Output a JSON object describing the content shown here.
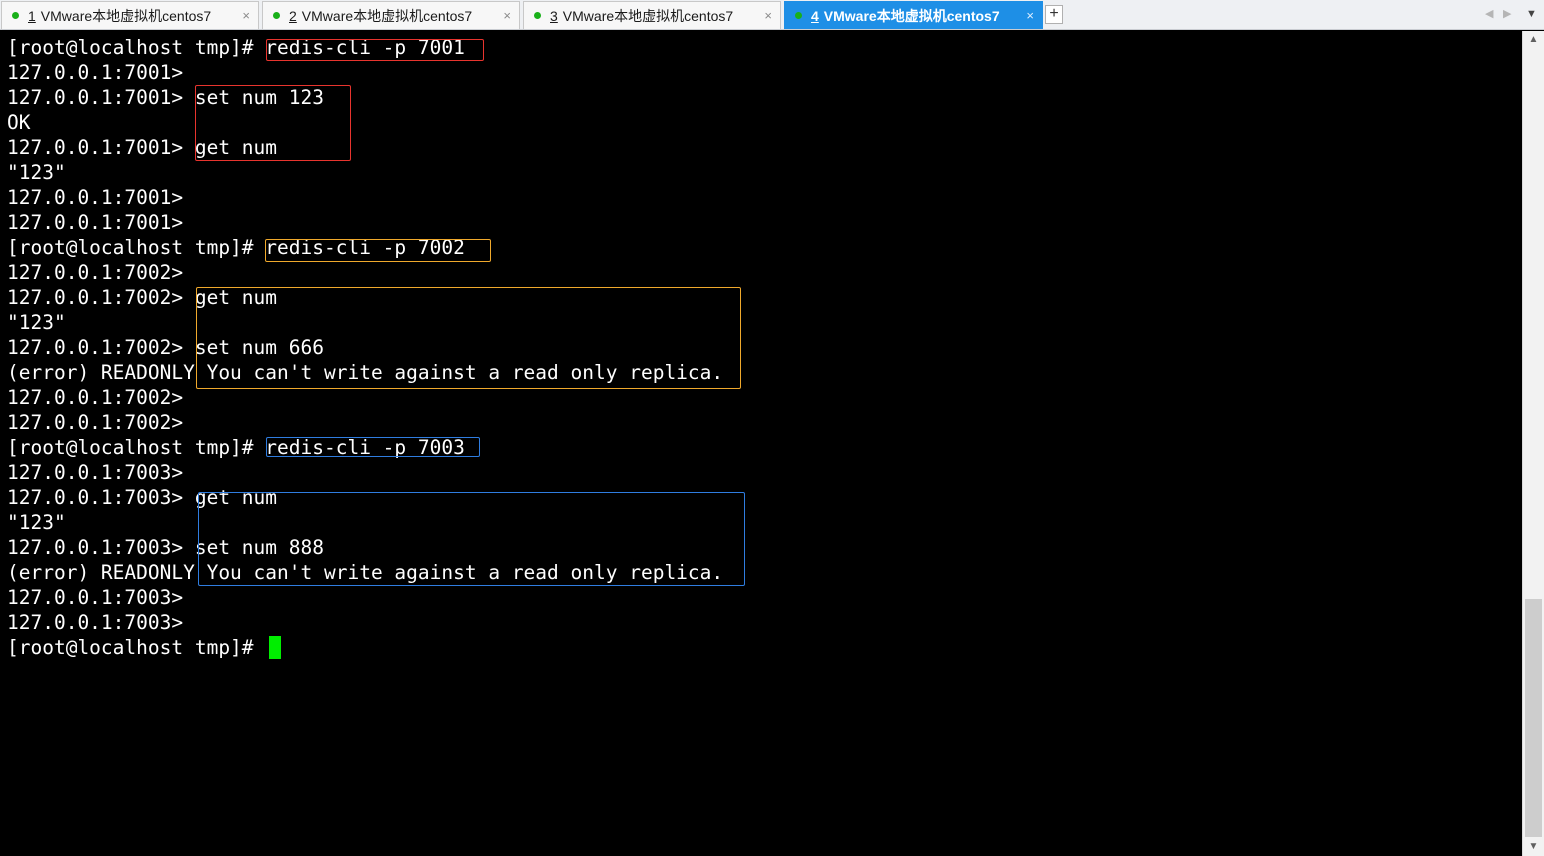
{
  "tabs": [
    {
      "number": "1",
      "title": "VMware本地虚拟机centos7",
      "active": false
    },
    {
      "number": "2",
      "title": "VMware本地虚拟机centos7",
      "active": false
    },
    {
      "number": "3",
      "title": "VMware本地虚拟机centos7",
      "active": false
    },
    {
      "number": "4",
      "title": "VMware本地虚拟机centos7",
      "active": true
    }
  ],
  "icons": {
    "close": "×",
    "add": "+",
    "nav_left": "◀",
    "nav_right": "▶",
    "menu": "▼",
    "scroll_up": "▲",
    "scroll_down": "▼"
  },
  "terminal": {
    "lines": [
      "[root@localhost tmp]# redis-cli -p 7001",
      "127.0.0.1:7001>",
      "127.0.0.1:7001> set num 123",
      "OK",
      "127.0.0.1:7001> get num",
      "\"123\"",
      "127.0.0.1:7001>",
      "127.0.0.1:7001>",
      "[root@localhost tmp]# redis-cli -p 7002",
      "127.0.0.1:7002>",
      "127.0.0.1:7002> get num",
      "\"123\"",
      "127.0.0.1:7002> set num 666",
      "(error) READONLY You can't write against a read only replica.",
      "127.0.0.1:7002>",
      "127.0.0.1:7002>",
      "[root@localhost tmp]# redis-cli -p 7003",
      "127.0.0.1:7003>",
      "127.0.0.1:7003> get num",
      "\"123\"",
      "127.0.0.1:7003> set num 888",
      "(error) READONLY You can't write against a read only replica.",
      "127.0.0.1:7003>",
      "127.0.0.1:7003>",
      "[root@localhost tmp]# "
    ]
  },
  "colors": {
    "terminal_bg": "#000000",
    "terminal_fg": "#ffffff",
    "cursor": "#00ee00",
    "highlight_7001": "#e8342e",
    "highlight_7002": "#f0a92c",
    "highlight_7003": "#2f7de0",
    "active_tab": "#1e8fe6",
    "status_dot": "#19b019"
  }
}
